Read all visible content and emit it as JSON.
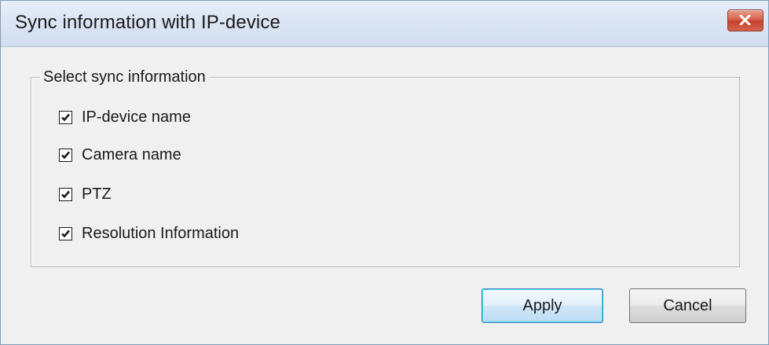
{
  "window": {
    "title": "Sync information with IP-device"
  },
  "group": {
    "legend": "Select sync information",
    "options": [
      {
        "label": "IP-device name",
        "checked": true
      },
      {
        "label": "Camera name",
        "checked": true
      },
      {
        "label": "PTZ",
        "checked": true
      },
      {
        "label": "Resolution Information",
        "checked": true
      }
    ]
  },
  "buttons": {
    "apply_label": "Apply",
    "cancel_label": "Cancel"
  },
  "colors": {
    "close_button": "#c7412c",
    "dialog_background": "#f0f0f0",
    "titlebar": "#dae4f3"
  },
  "icons": {
    "close": "close-icon",
    "check": "checkmark-icon"
  }
}
